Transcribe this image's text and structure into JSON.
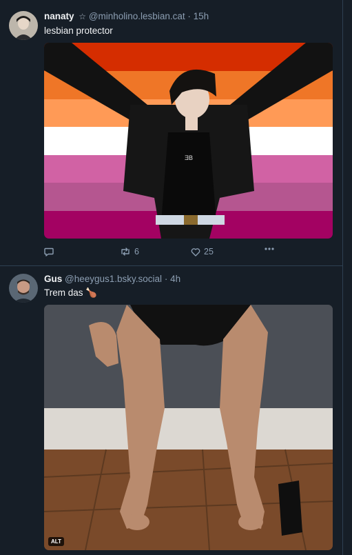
{
  "posts": [
    {
      "author_name": "nanaty",
      "badge_icon": "star-icon",
      "handle": "@minholino.lesbian.cat",
      "separator": "·",
      "time": "15h",
      "text": "lesbian protector",
      "image_flag_colors": [
        "#d52d00",
        "#ef7627",
        "#ff9a56",
        "#ffffff",
        "#d162a4",
        "#b55690",
        "#a30262"
      ],
      "actions": {
        "reply_count": "",
        "repost_count": "6",
        "like_count": "25"
      }
    },
    {
      "author_name": "Gus",
      "handle": "@heeygus1.bsky.social",
      "separator": "·",
      "time": "4h",
      "text": "Trem das 🍗",
      "alt_badge": "ALT"
    }
  ],
  "colors": {
    "background": "#161e27",
    "divider": "#2e4052",
    "muted": "#8c9eb2",
    "text": "#f1f3f5"
  }
}
